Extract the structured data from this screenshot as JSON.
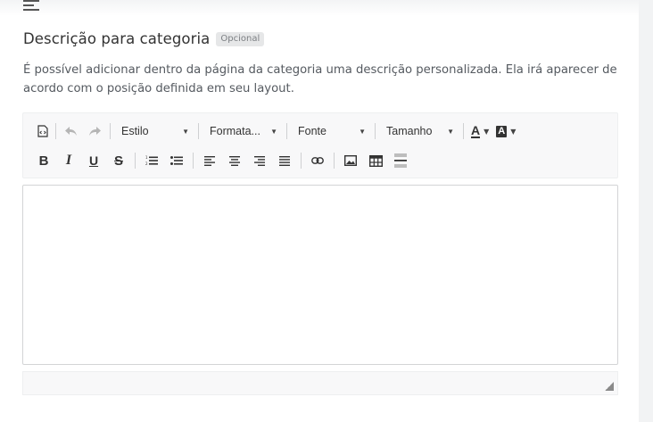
{
  "section": {
    "title": "Descrição para categoria",
    "badge": "Opcional",
    "description": "É possível adicionar dentro da página da categoria uma descrição personalizada. Ela irá aparecer de acordo com o posição definida em seu layout."
  },
  "toolbar": {
    "row1": {
      "source_icon": "source-code-icon",
      "undo_icon": "undo-icon",
      "redo_icon": "redo-icon",
      "style_label": "Estilo",
      "format_label": "Formata...",
      "font_label": "Fonte",
      "size_label": "Tamanho",
      "text_color_glyph": "A",
      "bg_color_glyph": "A"
    },
    "row2": {
      "bold": "B",
      "italic": "I",
      "underline": "U",
      "strike": "S"
    }
  },
  "editor": {
    "content": ""
  }
}
